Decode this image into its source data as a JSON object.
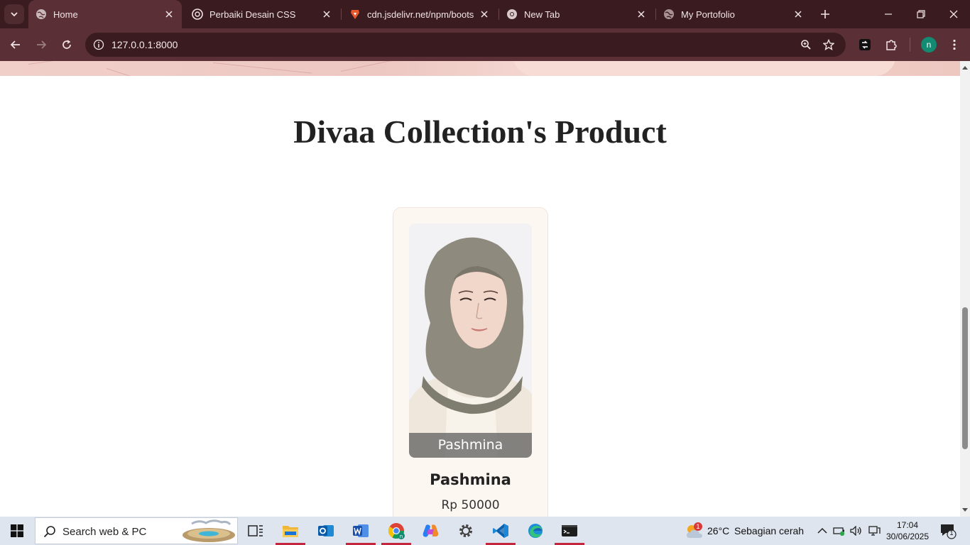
{
  "browser": {
    "tabs": [
      {
        "title": "Home",
        "active": true,
        "icon": "globe-icon"
      },
      {
        "title": "Perbaiki Desain CSS",
        "active": false,
        "icon": "openai-icon"
      },
      {
        "title": "cdn.jsdelivr.net/npm/bootstr",
        "active": false,
        "icon": "brave-icon"
      },
      {
        "title": "New Tab",
        "active": false,
        "icon": "chrome-icon"
      },
      {
        "title": "My Portofolio",
        "active": false,
        "icon": "globe-icon"
      }
    ],
    "url": "127.0.0.1:8000",
    "profile_initial": "n"
  },
  "page": {
    "section_title": "Divaa Collection's Product",
    "products": [
      {
        "caption": "Pashmina",
        "name": "Pashmina",
        "price": "Rp 50000"
      }
    ]
  },
  "taskbar": {
    "search_placeholder": "Search web & PC",
    "weather_temp": "26°C",
    "weather_desc": "Sebagian cerah",
    "weather_badge": "1",
    "time": "17:04",
    "date": "30/06/2025",
    "notification_count": "1",
    "apps": [
      "task-view",
      "file-explorer",
      "outlook",
      "word",
      "chrome",
      "copilot",
      "settings",
      "vscode",
      "edge",
      "terminal"
    ]
  },
  "colors": {
    "tabbar": "#3a1c20",
    "toolbar": "#5a2f35",
    "card_bg": "#fdf7f2",
    "taskbar": "#dfe5ee"
  }
}
